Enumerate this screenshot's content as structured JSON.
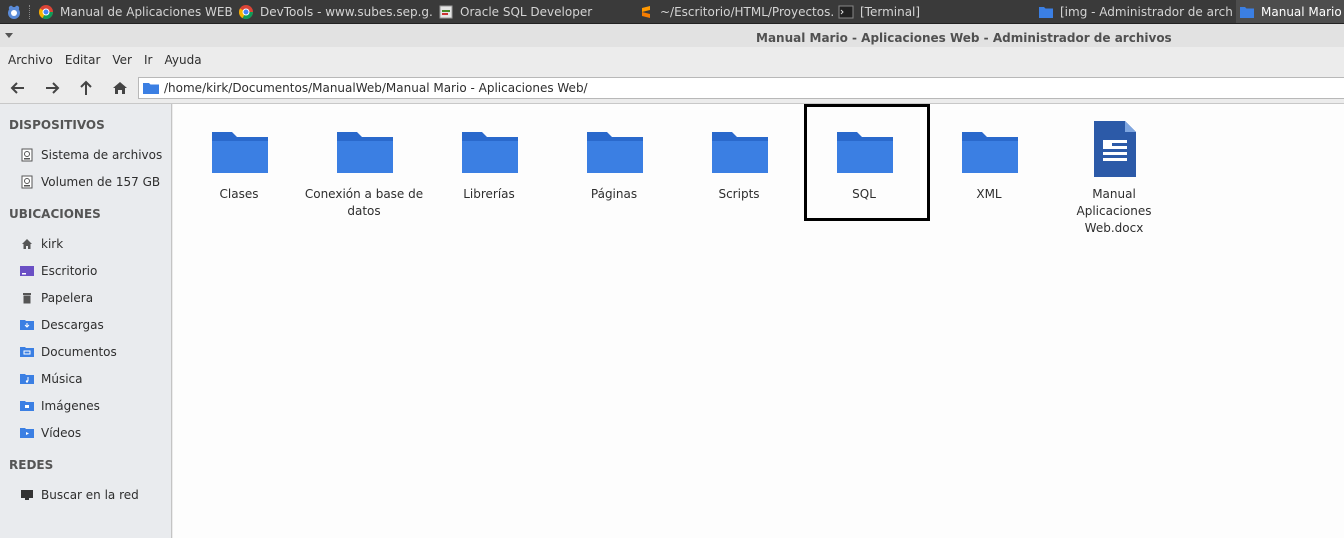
{
  "taskbar": {
    "tasks": [
      {
        "label": "Manual de Aplicaciones WEB...",
        "icon": "chrome-icon"
      },
      {
        "label": "DevTools - www.subes.sep.g...",
        "icon": "chrome-icon"
      },
      {
        "label": "Oracle SQL Developer",
        "icon": "sqldeveloper-icon"
      },
      {
        "label": "~/Escritorio/HTML/Proyectos...",
        "icon": "sublime-icon"
      },
      {
        "label": "[Terminal]",
        "icon": "terminal-icon"
      },
      {
        "label": "[img - Administrador de arch...",
        "icon": "folder-icon"
      },
      {
        "label": "Manual Mario - Aplicaciones Web",
        "icon": "folder-icon"
      }
    ]
  },
  "window": {
    "title": "Manual Mario - Aplicaciones Web - Administrador de archivos"
  },
  "menubar": {
    "items": [
      "Archivo",
      "Editar",
      "Ver",
      "Ir",
      "Ayuda"
    ]
  },
  "toolbar": {
    "path": "/home/kirk/Documentos/ManualWeb/Manual Mario - Aplicaciones Web/"
  },
  "sidebar": {
    "sections": [
      {
        "title": "DISPOSITIVOS",
        "items": [
          {
            "label": "Sistema de archivos",
            "icon": "drive-icon"
          },
          {
            "label": "Volumen de 157 GB",
            "icon": "drive-icon"
          }
        ]
      },
      {
        "title": "UBICACIONES",
        "items": [
          {
            "label": "kirk",
            "icon": "home-icon"
          },
          {
            "label": "Escritorio",
            "icon": "desktop-icon"
          },
          {
            "label": "Papelera",
            "icon": "trash-icon"
          },
          {
            "label": "Descargas",
            "icon": "downloads-folder-icon"
          },
          {
            "label": "Documentos",
            "icon": "documents-folder-icon"
          },
          {
            "label": "Música",
            "icon": "music-folder-icon"
          },
          {
            "label": "Imágenes",
            "icon": "pictures-folder-icon"
          },
          {
            "label": "Vídeos",
            "icon": "videos-folder-icon"
          }
        ]
      },
      {
        "title": "REDES",
        "items": [
          {
            "label": "Buscar en la red",
            "icon": "network-icon"
          }
        ]
      }
    ]
  },
  "files": [
    {
      "name": "Clases",
      "type": "folder"
    },
    {
      "name": "Conexión a base de datos",
      "type": "folder"
    },
    {
      "name": "Librerías",
      "type": "folder"
    },
    {
      "name": "Páginas",
      "type": "folder"
    },
    {
      "name": "Scripts",
      "type": "folder"
    },
    {
      "name": "SQL",
      "type": "folder"
    },
    {
      "name": "XML",
      "type": "folder"
    },
    {
      "name": "Manual Aplicaciones Web.docx",
      "type": "document"
    }
  ],
  "colors": {
    "folder": "#3b7fe3",
    "folder_tab": "#2a69cc",
    "doc": "#2c5aa8"
  }
}
